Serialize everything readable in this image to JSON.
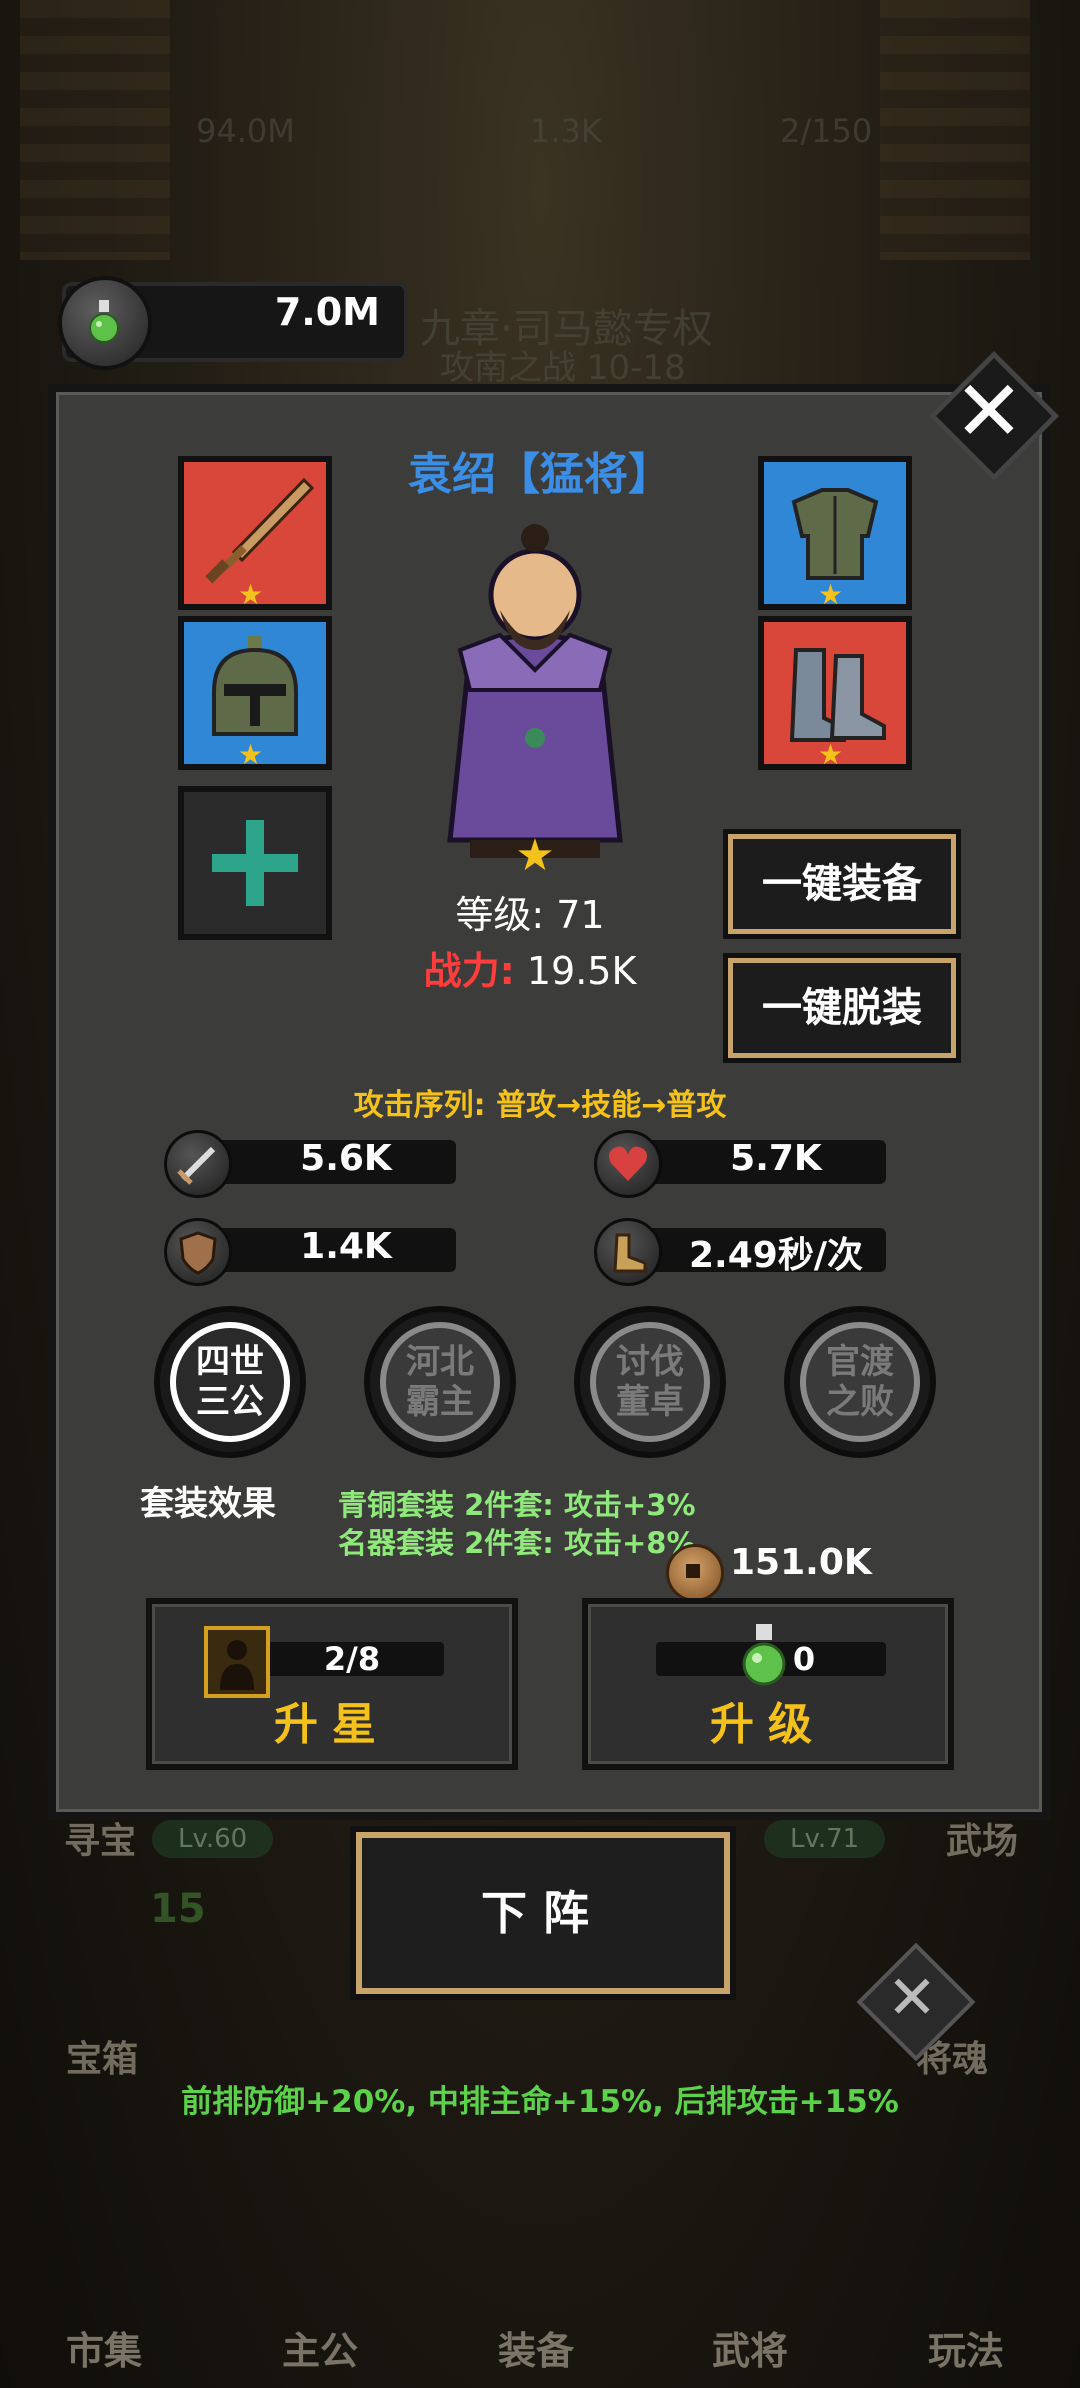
{
  "background": {
    "top_stats": [
      "94.0M",
      "1.3K",
      "2/150"
    ],
    "chapter_line1": "九章·司马懿专权",
    "chapter_line2": "攻南之战 10-18",
    "left_label": "寻宝",
    "right_label": "武场",
    "left_level": "Lv.60",
    "right_level": "Lv.71",
    "chest_label": "宝箱",
    "chest_count": "15",
    "soul_label": "将魂"
  },
  "potion_counter": {
    "value": "7.0M",
    "icon": "green-potion-icon"
  },
  "hero": {
    "name": "袁绍【猛将】",
    "level_text": "等级: 71",
    "power_label": "战力:",
    "power_value": "19.5K"
  },
  "equipment": [
    {
      "slot": "weapon",
      "icon": "sword-icon",
      "bg": "#d9463a",
      "stars": "★"
    },
    {
      "slot": "helmet",
      "icon": "helmet-icon",
      "bg": "#2f87d6",
      "stars": "★"
    },
    {
      "slot": "armor",
      "icon": "armor-icon",
      "bg": "#2f87d6",
      "stars": "★"
    },
    {
      "slot": "boots",
      "icon": "boots-icon",
      "bg": "#d9463a",
      "stars": "★"
    },
    {
      "slot": "extra",
      "icon": "plus-icon",
      "bg": "#2b2b2b",
      "stars": ""
    }
  ],
  "actions": {
    "equip_all": "一键装备",
    "unequip_all": "一键脱装"
  },
  "attack_sequence": "攻击序列: 普攻→技能→普攻",
  "stats": {
    "attack": "5.6K",
    "hp": "5.7K",
    "defense": "1.4K",
    "speed": "2.49秒/次"
  },
  "traits": [
    {
      "line1": "四世",
      "line2": "三公",
      "active": true
    },
    {
      "line1": "河北",
      "line2": "霸主",
      "active": false
    },
    {
      "line1": "讨伐",
      "line2": "董卓",
      "active": false
    },
    {
      "line1": "官渡",
      "line2": "之败",
      "active": false
    }
  ],
  "set_effects": {
    "label": "套装效果",
    "line1": "青铜套装 2件套:  攻击+3%",
    "line2": "名器套装 2件套:  攻击+8%"
  },
  "coins": "151.0K",
  "star_up": {
    "count": "2/8",
    "label": "升星"
  },
  "level_up": {
    "count": "0",
    "label": "升级"
  },
  "remove_button": "下阵",
  "formation_bonus": "前排防御+20%, 中排主命+15%, 后排攻击+15%",
  "bottom_nav": [
    "市集",
    "主公",
    "装备",
    "武将",
    "玩法"
  ],
  "colors": {
    "accent_gold": "#f4c21a",
    "name_blue": "#3a8ee6",
    "power_red": "#ff3d3d",
    "set_green": "#8fe87a",
    "bonus_green": "#5cd14a"
  }
}
